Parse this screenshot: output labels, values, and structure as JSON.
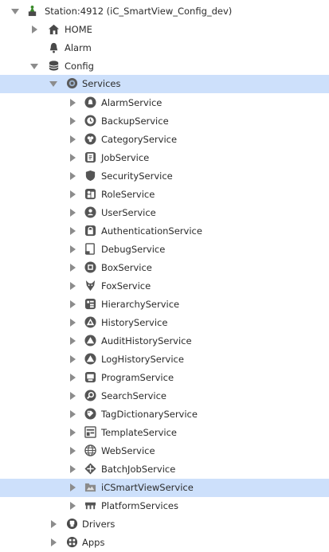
{
  "station": {
    "label": "Station:4912 (iC_SmartView_Config_dev)",
    "icon": "station-icon"
  },
  "home": {
    "label": "HOME",
    "icon": "home-icon"
  },
  "alarm": {
    "label": "Alarm",
    "icon": "bell-icon"
  },
  "config": {
    "label": "Config",
    "icon": "database-icon"
  },
  "services": {
    "label": "Services",
    "icon": "services-gear-icon",
    "selected": true
  },
  "service_items": [
    {
      "label": "AlarmService",
      "icon": "bell-icon"
    },
    {
      "label": "BackupService",
      "icon": "clock-backup-icon"
    },
    {
      "label": "CategoryService",
      "icon": "category-icon"
    },
    {
      "label": "JobService",
      "icon": "job-icon"
    },
    {
      "label": "SecurityService",
      "icon": "shield-icon"
    },
    {
      "label": "RoleService",
      "icon": "role-icon"
    },
    {
      "label": "UserService",
      "icon": "user-icon"
    },
    {
      "label": "AuthenticationService",
      "icon": "lock-icon"
    },
    {
      "label": "DebugService",
      "icon": "debug-icon"
    },
    {
      "label": "BoxService",
      "icon": "box-icon"
    },
    {
      "label": "FoxService",
      "icon": "fox-icon"
    },
    {
      "label": "HierarchyService",
      "icon": "hierarchy-icon"
    },
    {
      "label": "HistoryService",
      "icon": "history-icon"
    },
    {
      "label": "AuditHistoryService",
      "icon": "audit-history-icon"
    },
    {
      "label": "LogHistoryService",
      "icon": "log-history-icon"
    },
    {
      "label": "ProgramService",
      "icon": "program-icon"
    },
    {
      "label": "SearchService",
      "icon": "search-icon"
    },
    {
      "label": "TagDictionaryService",
      "icon": "tag-icon"
    },
    {
      "label": "TemplateService",
      "icon": "template-icon"
    },
    {
      "label": "WebService",
      "icon": "globe-icon"
    },
    {
      "label": "BatchJobService",
      "icon": "batch-job-icon"
    },
    {
      "label": "iCSmartViewService",
      "icon": "folder-image-icon",
      "selected": true
    },
    {
      "label": "PlatformServices",
      "icon": "platform-icon"
    }
  ],
  "drivers": {
    "label": "Drivers",
    "icon": "drivers-icon"
  },
  "apps": {
    "label": "Apps",
    "icon": "apps-icon"
  },
  "colors": {
    "selection": "#cde0fb",
    "text": "#2b2b2b",
    "twisty": "#8c8c8c",
    "icon": "#5a5a5a"
  }
}
